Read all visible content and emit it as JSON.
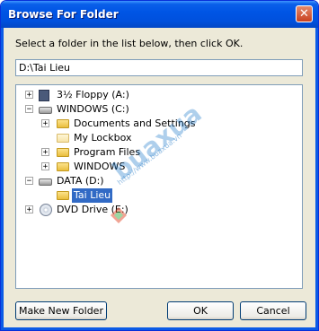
{
  "window": {
    "title": "Browse For Folder"
  },
  "dialog": {
    "instruction": "Select a folder in the list below, then click OK.",
    "path_value": "D:\\Tai Lieu"
  },
  "tree": {
    "items": [
      {
        "label": "3½ Floppy (A:)",
        "icon": "floppy-drive-icon",
        "expander": "+"
      },
      {
        "label": "WINDOWS (C:)",
        "icon": "hard-drive-icon",
        "expander": "−"
      },
      {
        "label": "Documents and Settings",
        "icon": "folder-icon",
        "expander": "+"
      },
      {
        "label": "My Lockbox",
        "icon": "folder-icon",
        "expander": ""
      },
      {
        "label": "Program Files",
        "icon": "folder-icon",
        "expander": "+"
      },
      {
        "label": "WINDOWS",
        "icon": "folder-icon",
        "expander": "+"
      },
      {
        "label": "DATA (D:)",
        "icon": "hard-drive-icon",
        "expander": "−"
      },
      {
        "label": "Tai Lieu",
        "icon": "folder-open-icon",
        "expander": "",
        "selected": true
      },
      {
        "label": "DVD Drive (E:)",
        "icon": "dvd-drive-icon",
        "expander": "+"
      }
    ]
  },
  "buttons": {
    "make_new_folder": "Make New Folder",
    "ok": "OK",
    "cancel": "Cancel",
    "close": "✕"
  },
  "watermark": {
    "brand": "buaxua",
    "url": "http://www.buaxua.vn"
  },
  "colors": {
    "title_bar": "#0055e5",
    "selection": "#316ac5",
    "dialog_bg": "#ece9d8",
    "border": "#7f9db9"
  }
}
